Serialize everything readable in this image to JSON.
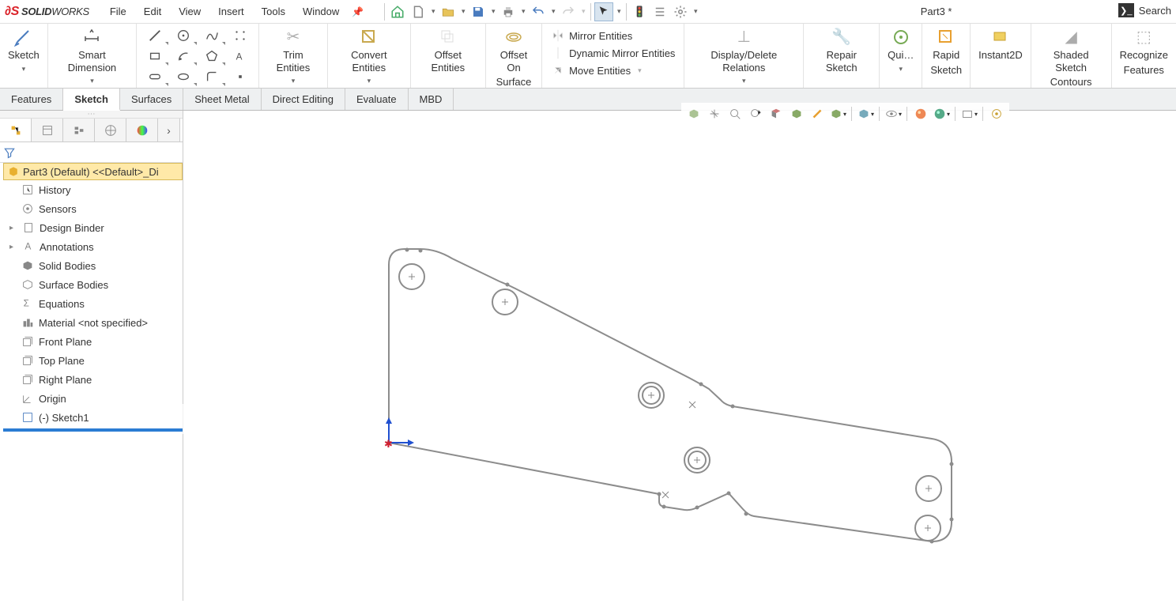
{
  "app": {
    "brand_prefix": "SOLID",
    "brand_suffix": "WORKS"
  },
  "menu": {
    "file": "File",
    "edit": "Edit",
    "view": "View",
    "insert": "Insert",
    "tools": "Tools",
    "window": "Window"
  },
  "title": "Part3 *",
  "search_placeholder": "Search",
  "ribbon": {
    "sketch": "Sketch",
    "smart_dim": "Smart Dimension",
    "trim": "Trim Entities",
    "convert": "Convert Entities",
    "offset": "Offset Entities",
    "offset_surface1": "Offset On",
    "offset_surface2": "Surface",
    "mirror": "Mirror Entities",
    "dyn_mirror": "Dynamic Mirror Entities",
    "move": "Move Entities",
    "disp_rel": "Display/Delete Relations",
    "repair": "Repair Sketch",
    "quick": "Qui…",
    "rapid1": "Rapid",
    "rapid2": "Sketch",
    "instant": "Instant2D",
    "shaded1": "Shaded Sketch",
    "shaded2": "Contours",
    "recog1": "Recognize",
    "recog2": "Features"
  },
  "tabs": {
    "features": "Features",
    "sketch": "Sketch",
    "surfaces": "Surfaces",
    "sheetmetal": "Sheet Metal",
    "direct": "Direct Editing",
    "evaluate": "Evaluate",
    "mbd": "MBD"
  },
  "tree": {
    "root": "Part3 (Default) <<Default>_Di",
    "history": "History",
    "sensors": "Sensors",
    "design_binder": "Design Binder",
    "annotations": "Annotations",
    "solid_bodies": "Solid Bodies",
    "surface_bodies": "Surface Bodies",
    "equations": "Equations",
    "material": "Material <not specified>",
    "front": "Front Plane",
    "top": "Top Plane",
    "right": "Right Plane",
    "origin": "Origin",
    "sketch1": "(-) Sketch1"
  }
}
